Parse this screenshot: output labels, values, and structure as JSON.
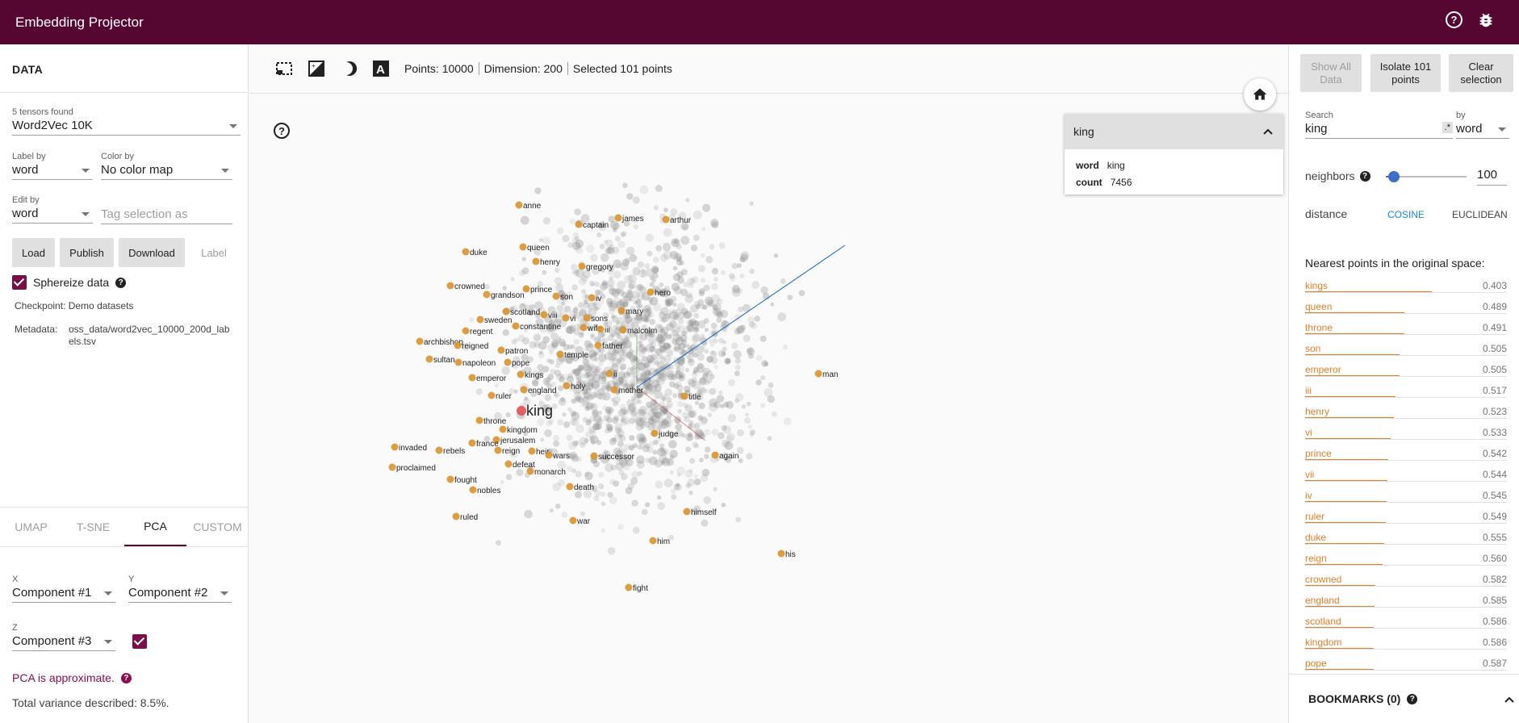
{
  "app_title": "Embedding Projector",
  "left": {
    "header": "DATA",
    "tensors_found": "5 tensors found",
    "tensor_selected": "Word2Vec 10K",
    "label_by_label": "Label by",
    "label_by_value": "word",
    "color_by_label": "Color by",
    "color_by_value": "No color map",
    "edit_by_label": "Edit by",
    "edit_by_value": "word",
    "tag_placeholder": "Tag selection as",
    "buttons": {
      "load": "Load",
      "publish": "Publish",
      "download": "Download",
      "label": "Label"
    },
    "sphereize": "Sphereize data",
    "checkpoint_label": "Checkpoint:",
    "checkpoint_value": "Demo datasets",
    "metadata_label": "Metadata:",
    "metadata_value": "oss_data/word2vec_10000_200d_labels.tsv",
    "tabs": [
      "UMAP",
      "T-SNE",
      "PCA",
      "CUSTOM"
    ],
    "x_label": "X",
    "x_value": "Component #1",
    "y_label": "Y",
    "y_value": "Component #2",
    "z_label": "Z",
    "z_value": "Component #3",
    "pca_note": "PCA is approximate.",
    "variance": "Total variance described: 8.5%."
  },
  "toolbar": {
    "points": "Points: 10000",
    "dimension": "Dimension: 200",
    "selected": "Selected 101 points"
  },
  "info_card": {
    "title": "king",
    "word_key": "word",
    "word_value": "king",
    "count_key": "count",
    "count_value": "7456"
  },
  "right": {
    "show_all": "Show All Data",
    "isolate": "Isolate 101 points",
    "clear": "Clear selection",
    "search_label": "Search",
    "search_value": "king",
    "regex": ".*",
    "by_label": "by",
    "by_value": "word",
    "neighbors_label": "neighbors",
    "neighbors_value": "100",
    "distance_label": "distance",
    "cosine": "COSINE",
    "euclidean": "EUCLIDEAN",
    "nearest_title": "Nearest points in the original space:",
    "bookmarks": "BOOKMARKS (0)",
    "nearest": [
      {
        "word": "kings",
        "dist": "0.403"
      },
      {
        "word": "queen",
        "dist": "0.489"
      },
      {
        "word": "throne",
        "dist": "0.491"
      },
      {
        "word": "son",
        "dist": "0.505"
      },
      {
        "word": "emperor",
        "dist": "0.505"
      },
      {
        "word": "iii",
        "dist": "0.517"
      },
      {
        "word": "henry",
        "dist": "0.523"
      },
      {
        "word": "vi",
        "dist": "0.533"
      },
      {
        "word": "prince",
        "dist": "0.542"
      },
      {
        "word": "vii",
        "dist": "0.544"
      },
      {
        "word": "iv",
        "dist": "0.545"
      },
      {
        "word": "ruler",
        "dist": "0.549"
      },
      {
        "word": "duke",
        "dist": "0.555"
      },
      {
        "word": "reign",
        "dist": "0.560"
      },
      {
        "word": "crowned",
        "dist": "0.582"
      },
      {
        "word": "england",
        "dist": "0.585"
      },
      {
        "word": "scotland",
        "dist": "0.586"
      },
      {
        "word": "kingdom",
        "dist": "0.586"
      },
      {
        "word": "pope",
        "dist": "0.587"
      }
    ]
  },
  "scatter_labels": [
    "anne",
    "captain",
    "james",
    "arthur",
    "queen",
    "duke",
    "henry",
    "gregory",
    "crowned",
    "prince",
    "grandson",
    "son",
    "hero",
    "scotland",
    "viii",
    "iv",
    "mary",
    "sweden",
    "vi",
    "sons",
    "regent",
    "constantine",
    "wife",
    "iii",
    "malcolm",
    "archbishop",
    "reigned",
    "patron",
    "father",
    "temple",
    "sultan",
    "napoleon",
    "pope",
    "ii",
    "man",
    "emperor",
    "kings",
    "england",
    "holy",
    "mother",
    "ruler",
    "title",
    "king",
    "throne",
    "kingdom",
    "judge",
    "jerusalem",
    "invaded",
    "rebels",
    "france",
    "reign",
    "heir",
    "wars",
    "successor",
    "again",
    "defeat",
    "proclaimed",
    "monarch",
    "fought",
    "nobles",
    "death",
    "ruled",
    "war",
    "himself",
    "him",
    "his",
    "fight"
  ]
}
